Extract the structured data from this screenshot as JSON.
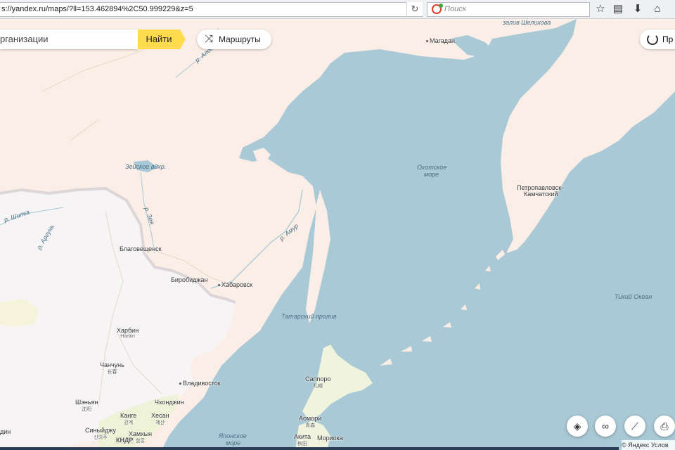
{
  "browser": {
    "url": "s://yandex.ru/maps/?ll=153.462894%2C50.999229&z=5",
    "search_placeholder": "Поиск",
    "reload_icon": "reload-icon",
    "toolbar_icons": [
      "star-icon",
      "clipboard-icon",
      "download-icon",
      "home-icon"
    ]
  },
  "map_ui": {
    "search_value": "рганизации",
    "find_label": "Найти",
    "routes_label": "Маршруты",
    "traffic_label": "Пр",
    "controls": [
      "layers-icon",
      "binoculars-icon",
      "ruler-icon",
      "print-icon"
    ],
    "copyright": "© Яндекс Услов"
  },
  "labels": {
    "shelikhov_bay": "залив Шелихова",
    "magadan": "Магадан",
    "okhotsk_sea_1": "Охотское",
    "okhotsk_sea_2": "море",
    "petropavlovsk_1": "Петропавловск-",
    "petropavlovsk_2": "Камчатский",
    "pacific": "Тихий Океан",
    "zeya_res": "Зейское вдхр.",
    "shilka": "р. Шилка",
    "argun": "р. Аргунь",
    "zeya": "р. Зея",
    "amur": "р. Амур",
    "aldan": "р. Алда",
    "blagoveshchensk": "Благовещенск",
    "birobidzhan": "Биробиджан",
    "khabarovsk": "Хабаровск",
    "tatar_strait": "Татарский пролив",
    "harbin": "Харбин",
    "harbin_sub": "Harbin",
    "changchun": "Чанчунь",
    "changchun_sub": "长春",
    "shenyang": "Шэньян",
    "shenyang_sub": "沈阳",
    "chongjin": "Чхонджин",
    "kange": "Канге",
    "kange_sub": "강계",
    "hyesan": "Хесан",
    "hyesan_sub": "혜산",
    "hamhung": "Хамхын",
    "hamhung_sub": "함흥",
    "sinuiju": "Синыйджу",
    "sinuiju_sub": "신의주",
    "kndr": "КНДР",
    "vladivostok": "Владивосток",
    "sapporo": "Саппоро",
    "sapporo_sub": "札幌",
    "aomori": "Аомори",
    "aomori_sub": "青森",
    "akita": "Акита",
    "akita_sub": "秋田",
    "morioka": "Мориока",
    "japan_sea_1": "Японское",
    "japan_sea_2": "море",
    "din": "дин"
  }
}
